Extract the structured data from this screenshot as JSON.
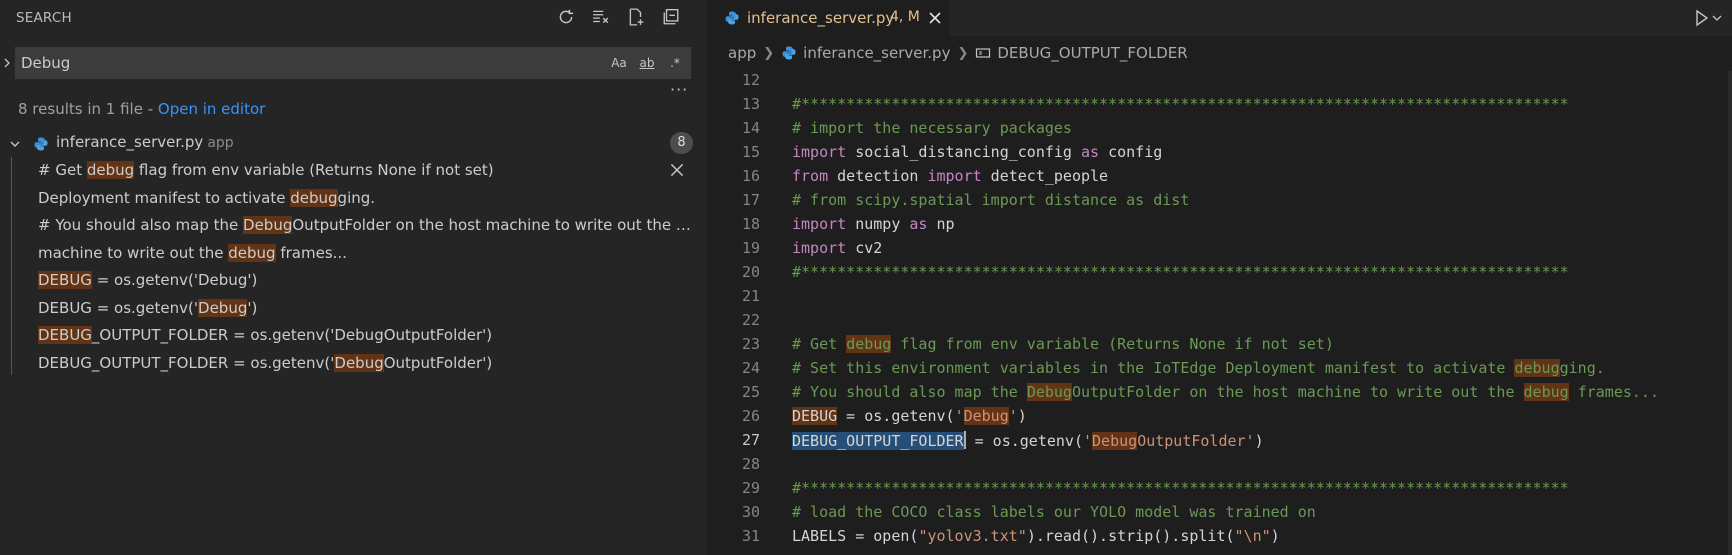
{
  "sidebar": {
    "title": "SEARCH",
    "query": "Debug",
    "options": {
      "match_case": "Aa",
      "whole_word": "ab",
      "regex": ".*"
    },
    "more": "···",
    "summary": {
      "text": "8 results in 1 file - ",
      "link": "Open in editor"
    },
    "file": {
      "name": "inferance_server.py",
      "dir": "app",
      "count": "8"
    },
    "results": [
      {
        "pre": "# Get ",
        "match": "debug",
        "post": " flag from env variable (Returns None if not set)"
      },
      {
        "pre": "Deployment manifest to activate ",
        "match": "debug",
        "post": "ging."
      },
      {
        "pre": "# You should also map the ",
        "match": "Debug",
        "post": "OutputFolder on the host machine to write out the debu..."
      },
      {
        "pre": "machine to write out the ",
        "match": "debug",
        "post": " frames..."
      },
      {
        "pre": "",
        "match": "DEBUG",
        "post": " = os.getenv('Debug')"
      },
      {
        "pre": "DEBUG = os.getenv('",
        "match": "Debug",
        "post": "')"
      },
      {
        "pre": "",
        "match": "DEBUG",
        "post": "_OUTPUT_FOLDER = os.getenv('DebugOutputFolder')"
      },
      {
        "pre": "DEBUG_OUTPUT_FOLDER = os.getenv('",
        "match": "Debug",
        "post": "OutputFolder')"
      }
    ]
  },
  "editor": {
    "tab": {
      "title": "inferance_server.py",
      "status": "4, M"
    },
    "breadcrumb": {
      "folder": "app",
      "file": "inferance_server.py",
      "symbol": "DEBUG_OUTPUT_FOLDER"
    },
    "current_line": "27",
    "lines": [
      {
        "n": "12",
        "segs": []
      },
      {
        "n": "13",
        "segs": [
          {
            "c": "cm",
            "t": "#*************************************************************************************"
          }
        ]
      },
      {
        "n": "14",
        "segs": [
          {
            "c": "cm",
            "t": "# import the necessary packages"
          }
        ]
      },
      {
        "n": "15",
        "segs": [
          {
            "c": "kw",
            "t": "import"
          },
          {
            "c": "",
            "t": " social_distancing_config "
          },
          {
            "c": "kw",
            "t": "as"
          },
          {
            "c": "",
            "t": " config"
          }
        ]
      },
      {
        "n": "16",
        "segs": [
          {
            "c": "kw",
            "t": "from"
          },
          {
            "c": "",
            "t": " detection "
          },
          {
            "c": "kw",
            "t": "import"
          },
          {
            "c": "",
            "t": " detect_people"
          }
        ]
      },
      {
        "n": "17",
        "segs": [
          {
            "c": "cm",
            "t": "# from scipy.spatial import distance as dist"
          }
        ]
      },
      {
        "n": "18",
        "segs": [
          {
            "c": "kw",
            "t": "import"
          },
          {
            "c": "",
            "t": " numpy "
          },
          {
            "c": "kw",
            "t": "as"
          },
          {
            "c": "",
            "t": " np"
          }
        ]
      },
      {
        "n": "19",
        "segs": [
          {
            "c": "kw",
            "t": "import"
          },
          {
            "c": "",
            "t": " cv2"
          }
        ]
      },
      {
        "n": "20",
        "segs": [
          {
            "c": "cm",
            "t": "#*************************************************************************************"
          }
        ]
      },
      {
        "n": "21",
        "segs": []
      },
      {
        "n": "22",
        "segs": []
      },
      {
        "n": "23",
        "segs": [
          {
            "c": "cm",
            "t": "# Get "
          },
          {
            "c": "cm fhl",
            "t": "debug"
          },
          {
            "c": "cm",
            "t": " flag from env variable (Returns None if not set)"
          }
        ]
      },
      {
        "n": "24",
        "segs": [
          {
            "c": "cm",
            "t": "# Set this environment variables in the IoTEdge Deployment manifest to activate "
          },
          {
            "c": "cm fhl",
            "t": "debug"
          },
          {
            "c": "cm",
            "t": "ging."
          }
        ]
      },
      {
        "n": "25",
        "segs": [
          {
            "c": "cm",
            "t": "# You should also map the "
          },
          {
            "c": "cm fhl",
            "t": "Debug"
          },
          {
            "c": "cm",
            "t": "OutputFolder on the host machine to write out the "
          },
          {
            "c": "cm fhl",
            "t": "debug"
          },
          {
            "c": "cm",
            "t": " frames..."
          }
        ]
      },
      {
        "n": "26",
        "segs": [
          {
            "c": "fhl",
            "t": "DEBUG"
          },
          {
            "c": "",
            "t": " = os.getenv("
          },
          {
            "c": "st",
            "t": "'"
          },
          {
            "c": "st fhl",
            "t": "Debug"
          },
          {
            "c": "st",
            "t": "'"
          },
          {
            "c": "",
            "t": ")"
          }
        ]
      },
      {
        "n": "27",
        "segs": [
          {
            "c": "sel",
            "t": "DEBUG_OUTPUT_FOLDER"
          },
          {
            "c": "cursor",
            "t": ""
          },
          {
            "c": "",
            "t": " = os.getenv("
          },
          {
            "c": "st",
            "t": "'"
          },
          {
            "c": "st fhl",
            "t": "Debug"
          },
          {
            "c": "st",
            "t": "OutputFolder'"
          },
          {
            "c": "",
            "t": ")"
          }
        ]
      },
      {
        "n": "28",
        "segs": []
      },
      {
        "n": "29",
        "segs": [
          {
            "c": "cm",
            "t": "#*************************************************************************************"
          }
        ]
      },
      {
        "n": "30",
        "segs": [
          {
            "c": "cm",
            "t": "# load the COCO class labels our YOLO model was trained on"
          }
        ]
      },
      {
        "n": "31",
        "segs": [
          {
            "c": "",
            "t": "LABELS = open("
          },
          {
            "c": "st",
            "t": "\"yolov3.txt\""
          },
          {
            "c": "",
            "t": ").read().strip().split("
          },
          {
            "c": "st",
            "t": "\"\\n\""
          },
          {
            "c": "",
            "t": ")"
          }
        ]
      }
    ]
  }
}
